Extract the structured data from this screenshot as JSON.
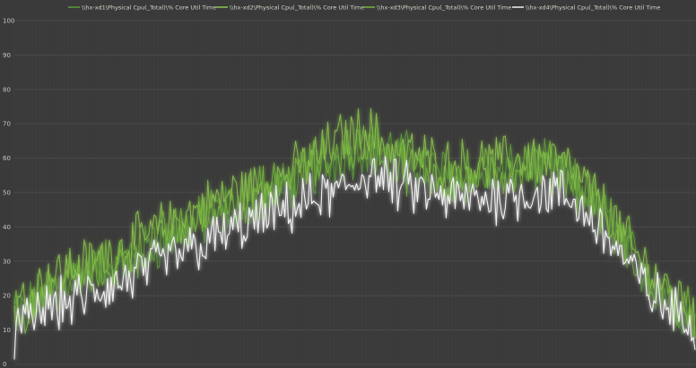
{
  "chart_data": {
    "type": "line",
    "title": "",
    "xlabel": "",
    "ylabel": "",
    "ylim": [
      0,
      100
    ],
    "yticks": [
      "0",
      "10",
      "20",
      "30",
      "40",
      "50",
      "60",
      "70",
      "80",
      "90",
      "100"
    ],
    "grid": true,
    "legend_position": "top",
    "colors": {
      "background": "#3a3a3a",
      "grid": "#4a4a4a"
    },
    "x": [
      0,
      0.04,
      0.08,
      0.12,
      0.16,
      0.2,
      0.24,
      0.28,
      0.32,
      0.36,
      0.4,
      0.44,
      0.48,
      0.52,
      0.56,
      0.6,
      0.64,
      0.68,
      0.72,
      0.76,
      0.8,
      0.84,
      0.88,
      0.92,
      0.96,
      1
    ],
    "series": [
      {
        "name": "\\\\hx-xd1\\Physical Cpu(_Total)\\% Core Util Time",
        "color": "#5e9a3c",
        "values": [
          14,
          20,
          25,
          27,
          30,
          34,
          38,
          42,
          46,
          48,
          52,
          56,
          60,
          64,
          62,
          58,
          55,
          54,
          56,
          58,
          56,
          50,
          40,
          28,
          20,
          13
        ]
      },
      {
        "name": "\\\\hx-xd2\\Physical Cpu(_Total)\\% Core Util Time",
        "color": "#8cc44e",
        "values": [
          16,
          24,
          28,
          30,
          34,
          38,
          42,
          46,
          50,
          52,
          55,
          60,
          66,
          68,
          62,
          60,
          58,
          58,
          59,
          60,
          59,
          52,
          42,
          30,
          22,
          15
        ]
      },
      {
        "name": "\\\\hx-xd3\\Physical Cpu(_Total)\\% Core Util Time",
        "color": "#76b43e",
        "values": [
          13,
          20,
          24,
          27,
          30,
          35,
          39,
          43,
          47,
          50,
          53,
          58,
          62,
          64,
          58,
          56,
          54,
          55,
          56,
          58,
          57,
          50,
          40,
          27,
          19,
          13
        ]
      },
      {
        "name": "\\\\hx-xd4\\Physical Cpu(_Total)\\% Core Util Time",
        "color": "#f2f2f2",
        "values": [
          9,
          16,
          18,
          21,
          24,
          28,
          32,
          35,
          39,
          42,
          45,
          48,
          50,
          56,
          52,
          50,
          48,
          48,
          49,
          50,
          50,
          44,
          35,
          24,
          16,
          12
        ]
      }
    ]
  }
}
